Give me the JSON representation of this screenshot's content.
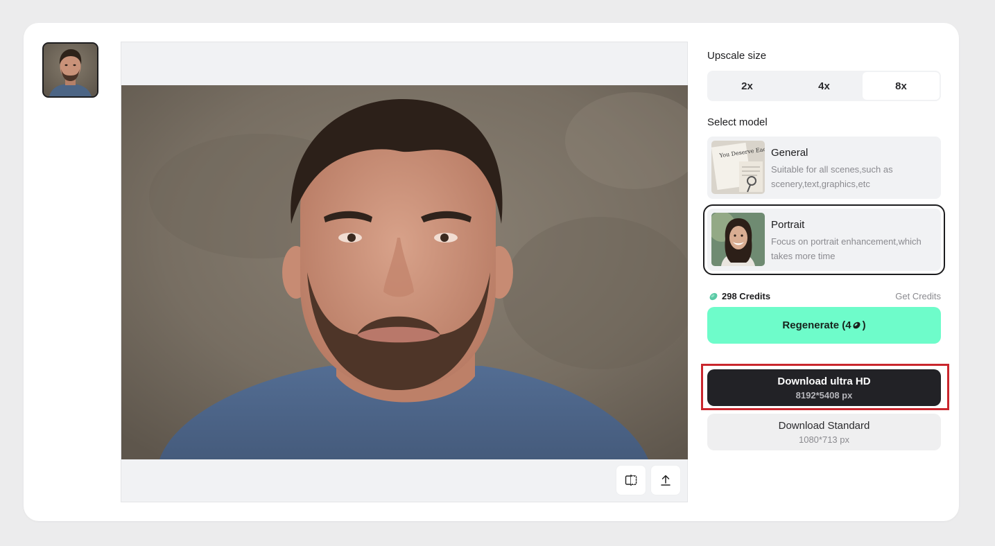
{
  "preview": {
    "thumbnail_alt": "Portrait thumbnail",
    "tools": {
      "compare_icon": "split-compare-icon",
      "export_icon": "upload-icon"
    }
  },
  "panel": {
    "upscale": {
      "label": "Upscale size",
      "options": [
        "2x",
        "4x",
        "8x"
      ],
      "selected": "8x"
    },
    "model": {
      "label": "Select model",
      "items": [
        {
          "name": "General",
          "description": "Suitable for all scenes,such as scenery,text,graphics,etc",
          "thumb_text": "You Deserve Each Other",
          "selected": false
        },
        {
          "name": "Portrait",
          "description": "Focus on portrait enhancement,which takes more time",
          "selected": true
        }
      ]
    },
    "credits": {
      "amount": "298 Credits",
      "get_link": "Get Credits"
    },
    "regenerate": {
      "label": "Regenerate (4",
      "suffix": ")"
    },
    "download_hd": {
      "title": "Download ultra HD",
      "size": "8192*5408 px"
    },
    "download_standard": {
      "title": "Download Standard",
      "size": "1080*713 px"
    }
  },
  "colors": {
    "accent": "#6efcca",
    "dark_button": "#222226",
    "highlight_border": "#c9262d",
    "credit_icon": "#59c9a5"
  }
}
